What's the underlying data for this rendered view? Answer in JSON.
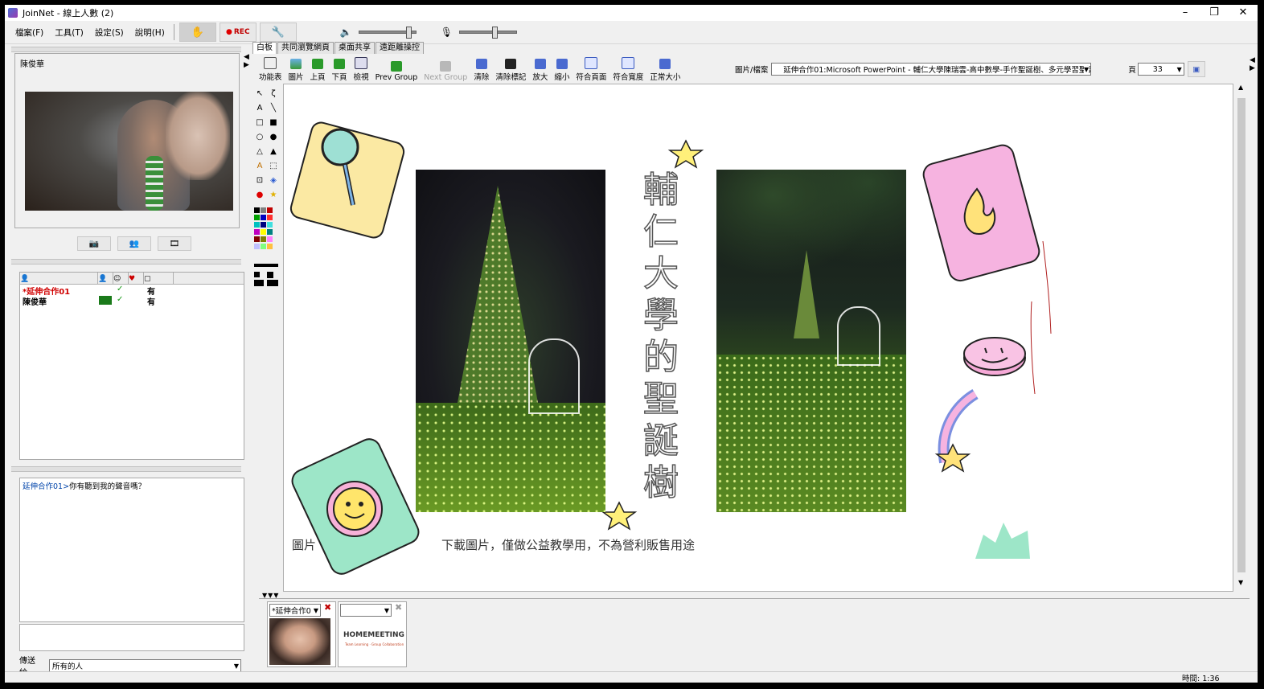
{
  "window": {
    "title": "JoinNet - 線上人數 (2)",
    "controls": [
      "–",
      "❐",
      "✕"
    ]
  },
  "menubar": {
    "items": [
      "檔案(F)",
      "工具(T)",
      "設定(S)",
      "說明(H)"
    ],
    "rec_label": "REC"
  },
  "video_panel": {
    "user_name": "陳俊華"
  },
  "users": {
    "rows": [
      {
        "name": "*延伸合作01",
        "color": "#d00000",
        "status": "有"
      },
      {
        "name": "陳俊華",
        "color": "#000000",
        "status": "有"
      }
    ]
  },
  "chat": {
    "messages": [
      {
        "sender": "延伸合作01>",
        "text": "你有聽到我的聲音嗎？"
      }
    ],
    "send_to_label": "傳送給:",
    "send_to_value": "所有的人"
  },
  "tabs": [
    "白板",
    "共同瀏覽網頁",
    "桌面共享",
    "遠距離操控"
  ],
  "toolbar": {
    "tools": [
      {
        "label": "功能表",
        "icon": "menu-icon"
      },
      {
        "label": "圖片",
        "icon": "picture-icon"
      },
      {
        "label": "上頁",
        "icon": "prev-page-icon"
      },
      {
        "label": "下頁",
        "icon": "next-page-icon"
      },
      {
        "label": "檢視",
        "icon": "view-icon"
      },
      {
        "label": "Prev Group",
        "icon": "prev-group-icon"
      },
      {
        "label": "Next Group",
        "icon": "next-group-icon",
        "disabled": true
      },
      {
        "label": "清除",
        "icon": "clear-icon"
      },
      {
        "label": "清除標記",
        "icon": "clear-marks-icon"
      },
      {
        "label": "放大",
        "icon": "zoom-in-icon"
      },
      {
        "label": "縮小",
        "icon": "zoom-out-icon"
      },
      {
        "label": "符合頁面",
        "icon": "fit-page-icon"
      },
      {
        "label": "符合寬度",
        "icon": "fit-width-icon"
      },
      {
        "label": "正常大小",
        "icon": "normal-size-icon"
      }
    ],
    "file_label": "圖片/檔案",
    "file_value": "延伸合作01:Microsoft PowerPoint - 輔仁大學陳瑞雲-高中數學-手作聖誕樹、多元學習聖誕樹",
    "page_label": "頁",
    "page_value": "33"
  },
  "slide": {
    "title_chars": [
      "輔",
      "仁",
      "大",
      "學",
      "的",
      "聖",
      "誕",
      "樹"
    ],
    "caption_left": "圖片",
    "caption_right": "下載圖片，僅做公益教學用，不為營利販售用途"
  },
  "participants_strip": {
    "selector_value": "*延伸合作0",
    "logo_text": "HOMEMEETING",
    "logo_sub": "Team Learning · Group Collaboration"
  },
  "status": {
    "time_label": "時間: 1:36"
  }
}
